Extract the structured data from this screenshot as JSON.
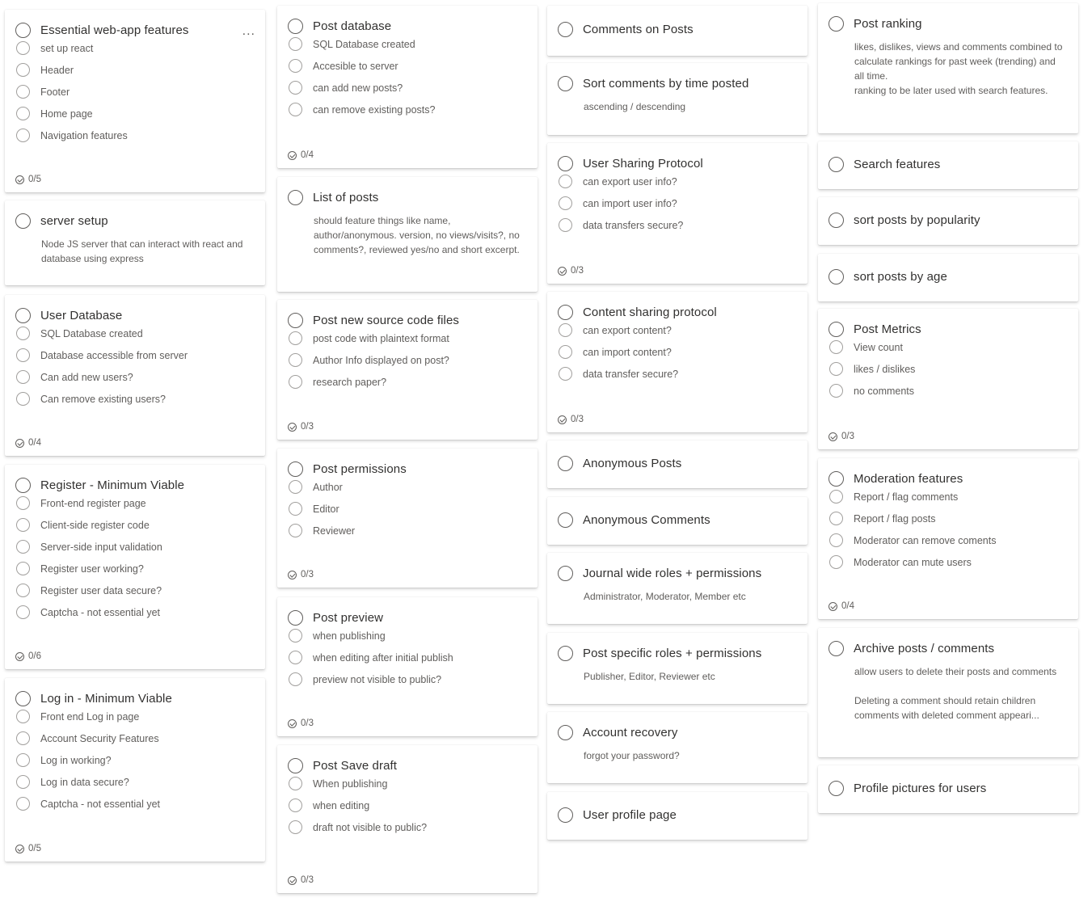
{
  "columns": [
    [
      {
        "title": "Essential web-app features",
        "more_icon": "...",
        "items": [
          "set up react",
          "Header",
          "Footer",
          "Home page",
          "Navigation features"
        ],
        "progress": "0/5"
      },
      {
        "title": "server setup",
        "description": [
          "Node JS server that can interact with react and database using express"
        ]
      },
      {
        "title": "User Database",
        "items": [
          "SQL Database created",
          "Database accessible from server",
          "Can add new users?",
          "Can remove existing users?"
        ],
        "progress": "0/4"
      },
      {
        "title": "Register - Minimum Viable",
        "items": [
          "Front-end register page",
          "Client-side register code",
          "Server-side input validation",
          "Register user working?",
          "Register user data secure?",
          "Captcha - not essential yet"
        ],
        "progress": "0/6"
      },
      {
        "title": "Log in - Minimum Viable",
        "items": [
          "Front end Log in page",
          "Account Security Features",
          "Log in working?",
          "Log in data secure?",
          "Captcha - not essential yet"
        ],
        "progress": "0/5"
      }
    ],
    [
      {
        "title": "Post database",
        "items": [
          "SQL Database created",
          "Accesible to server",
          "can add new posts?",
          "can remove existing posts?"
        ],
        "progress": "0/4"
      },
      {
        "title": "List of posts",
        "description": [
          "should feature things like name, author/anonymous. version, no views/visits?, no comments?, reviewed yes/no and short excerpt."
        ]
      },
      {
        "title": "Post new source code files",
        "items": [
          "post code with plaintext format",
          "Author Info displayed on post?",
          "research paper?"
        ],
        "progress": "0/3"
      },
      {
        "title": "Post permissions",
        "items": [
          "Author",
          "Editor",
          "Reviewer"
        ],
        "progress": "0/3"
      },
      {
        "title": "Post preview",
        "items": [
          "when publishing",
          "when editing after initial publish",
          "preview not visible to public?"
        ],
        "progress": "0/3"
      },
      {
        "title": "Post Save draft",
        "items": [
          "When publishing",
          "when editing",
          "draft not visible to public?"
        ],
        "progress": "0/3"
      }
    ],
    [
      {
        "title": "Comments on Posts"
      },
      {
        "title": "Sort comments by time posted",
        "description": [
          "ascending / descending"
        ]
      },
      {
        "title": "User Sharing Protocol",
        "items": [
          "can export user info?",
          "can import user info?",
          "data transfers secure?"
        ],
        "progress": "0/3"
      },
      {
        "title": "Content sharing protocol",
        "items": [
          "can export content?",
          "can import content?",
          "data transfer secure?"
        ],
        "progress": "0/3"
      },
      {
        "title": "Anonymous Posts"
      },
      {
        "title": "Anonymous Comments"
      },
      {
        "title": "Journal wide roles + permissions",
        "description": [
          "Administrator, Moderator, Member etc"
        ]
      },
      {
        "title": "Post specific roles + permissions",
        "description": [
          "Publisher, Editor, Reviewer etc"
        ]
      },
      {
        "title": "Account recovery",
        "description": [
          "forgot your password?"
        ]
      },
      {
        "title": "User profile page"
      }
    ],
    [
      {
        "title": "Post ranking",
        "description": [
          "likes, dislikes, views and comments combined to calculate rankings for past week (trending) and all time.",
          "ranking to be later used with search features."
        ]
      },
      {
        "title": "Search features"
      },
      {
        "title": "sort posts by popularity"
      },
      {
        "title": "sort posts by age"
      },
      {
        "title": "Post Metrics",
        "items": [
          "View count",
          "likes / dislikes",
          "no comments"
        ],
        "progress": "0/3"
      },
      {
        "title": "Moderation features",
        "items": [
          "Report / flag comments",
          "Report / flag posts",
          "Moderator can remove coments",
          "Moderator can mute users"
        ],
        "progress": "0/4"
      },
      {
        "title": "Archive posts / comments",
        "description": [
          "allow users to delete their posts and comments",
          "",
          "Deleting a comment should retain children comments with deleted comment appeari..."
        ]
      },
      {
        "title": "Profile pictures for users"
      }
    ]
  ]
}
